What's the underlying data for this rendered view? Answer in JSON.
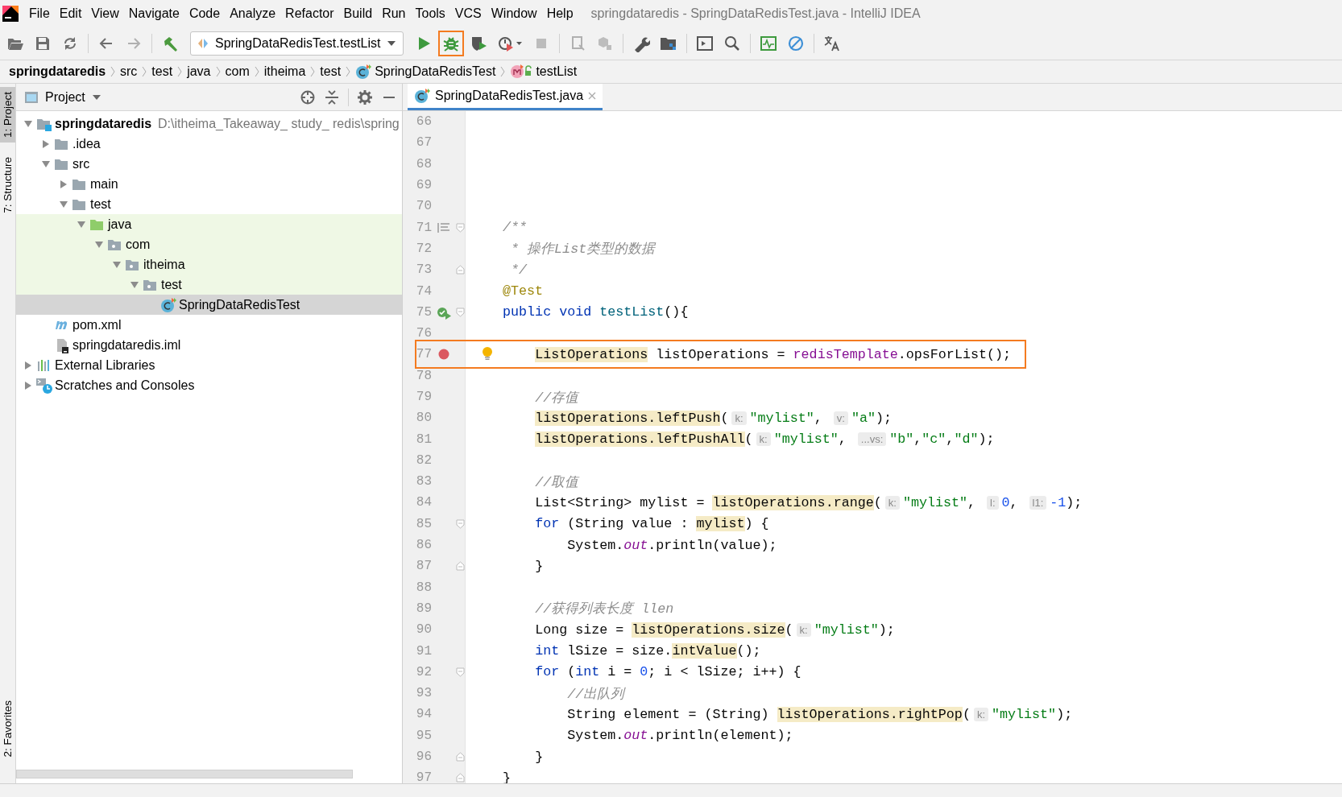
{
  "menu_bar": {
    "items": [
      "File",
      "Edit",
      "View",
      "Navigate",
      "Code",
      "Analyze",
      "Refactor",
      "Build",
      "Run",
      "Tools",
      "VCS",
      "Window",
      "Help"
    ],
    "title": "springdataredis - SpringDataRedisTest.java - IntelliJ IDEA"
  },
  "toolbar": {
    "run_configuration": "SpringDataRedisTest.testList",
    "debug_button": {
      "outlined": true
    }
  },
  "breadcrumbs": [
    {
      "label": "springdataredis",
      "kind": "module"
    },
    {
      "label": "src",
      "kind": "folder"
    },
    {
      "label": "test",
      "kind": "folder"
    },
    {
      "label": "java",
      "kind": "folder"
    },
    {
      "label": "com",
      "kind": "folder"
    },
    {
      "label": "itheima",
      "kind": "folder"
    },
    {
      "label": "test",
      "kind": "folder"
    },
    {
      "label": "SpringDataRedisTest",
      "kind": "class"
    },
    {
      "label": "testList",
      "kind": "method"
    }
  ],
  "side_tabs_top": [
    {
      "label": "1: Project",
      "selected": true
    },
    {
      "label": "7: Structure",
      "selected": false
    }
  ],
  "side_tabs_bottom": [
    {
      "label": "2: Favorites",
      "selected": false
    }
  ],
  "project_panel": {
    "title": "Project",
    "tree": [
      {
        "label": "springdataredis",
        "path": "D:\\itheima_Takeaway_ study_ redis\\spring",
        "kind": "module",
        "expanded": true,
        "selected": false,
        "highlighted": false,
        "children": [
          {
            "label": ".idea",
            "kind": "folder",
            "expanded": false,
            "selected": false,
            "highlighted": false
          },
          {
            "label": "src",
            "kind": "folder",
            "expanded": true,
            "selected": false,
            "highlighted": false,
            "children": [
              {
                "label": "main",
                "kind": "folder",
                "expanded": false,
                "selected": false,
                "highlighted": false
              },
              {
                "label": "test",
                "kind": "folder",
                "expanded": true,
                "selected": false,
                "highlighted": false,
                "children": [
                  {
                    "label": "java",
                    "kind": "test-root",
                    "expanded": true,
                    "selected": false,
                    "highlighted": true,
                    "children": [
                      {
                        "label": "com",
                        "kind": "package",
                        "expanded": true,
                        "selected": false,
                        "highlighted": true,
                        "children": [
                          {
                            "label": "itheima",
                            "kind": "package",
                            "expanded": true,
                            "selected": false,
                            "highlighted": true,
                            "children": [
                              {
                                "label": "test",
                                "kind": "package",
                                "expanded": true,
                                "selected": false,
                                "highlighted": true,
                                "children": [
                                  {
                                    "label": "SpringDataRedisTest",
                                    "kind": "class",
                                    "selected": true,
                                    "highlighted": false
                                  }
                                ]
                              }
                            ]
                          }
                        ]
                      }
                    ]
                  }
                ]
              }
            ]
          },
          {
            "label": "pom.xml",
            "kind": "maven",
            "selected": false,
            "highlighted": false
          },
          {
            "label": "springdataredis.iml",
            "kind": "iml",
            "selected": false,
            "highlighted": false
          }
        ]
      },
      {
        "label": "External Libraries",
        "kind": "libraries",
        "expanded": false,
        "selected": false,
        "highlighted": false
      },
      {
        "label": "Scratches and Consoles",
        "kind": "scratches",
        "expanded": false,
        "selected": false,
        "highlighted": false
      }
    ]
  },
  "editor": {
    "tabs": [
      {
        "label": "SpringDataRedisTest.java",
        "selected": true
      }
    ],
    "lines": [
      {
        "number": "66"
      },
      {
        "number": "67"
      },
      {
        "number": "68"
      },
      {
        "number": "69"
      },
      {
        "number": "70"
      },
      {
        "number": "71",
        "gutter_icon": {
          "kind": "javadoc"
        },
        "fold_mark": {
          "kind": "start"
        },
        "tokens": [
          {
            "kind": "comment",
            "t": "    /**"
          }
        ]
      },
      {
        "number": "72",
        "tokens": [
          {
            "kind": "comment",
            "t": "     * 操作List类型的数据"
          }
        ]
      },
      {
        "number": "73",
        "fold_mark": {
          "kind": "end"
        },
        "tokens": [
          {
            "kind": "comment",
            "t": "     */"
          }
        ]
      },
      {
        "number": "74",
        "tokens": [
          {
            "kind": "annotation",
            "t": "    @Test"
          }
        ]
      },
      {
        "number": "75",
        "gutter_icon": {
          "kind": "run"
        },
        "fold_mark": {
          "kind": "start"
        },
        "tokens": [
          {
            "kind": "keyword",
            "t": "    public void "
          },
          {
            "kind": "declaration",
            "t": "testList"
          },
          {
            "kind": "plain",
            "t": "(){"
          }
        ]
      },
      {
        "number": "76"
      },
      {
        "number": "77",
        "gutter_icon": {
          "kind": "breakpoint"
        },
        "bulb": true,
        "boxed": true,
        "tokens": [
          {
            "kind": "highlight",
            "t": "        ListOperations"
          },
          {
            "kind": "plain",
            "t": " listOperations = "
          },
          {
            "kind": "field",
            "t": "redisTemplate"
          },
          {
            "kind": "plain",
            "t": ".opsForList();"
          }
        ]
      },
      {
        "number": "78"
      },
      {
        "number": "79",
        "tokens": [
          {
            "kind": "comment",
            "t": "        //存值"
          }
        ]
      },
      {
        "number": "80",
        "tokens": [
          {
            "kind": "highlight",
            "t": "        listOperations.leftPush"
          },
          {
            "kind": "plain",
            "t": "("
          },
          {
            "kind": "hint",
            "t": "k:"
          },
          {
            "kind": "string",
            "t": "\"mylist\""
          },
          {
            "kind": "plain",
            "t": ", "
          },
          {
            "kind": "hint",
            "t": "v:"
          },
          {
            "kind": "string",
            "t": "\"a\""
          },
          {
            "kind": "plain",
            "t": ");"
          }
        ]
      },
      {
        "number": "81",
        "tokens": [
          {
            "kind": "highlight",
            "t": "        listOperations.leftPushAll"
          },
          {
            "kind": "plain",
            "t": "("
          },
          {
            "kind": "hint",
            "t": "k:"
          },
          {
            "kind": "string",
            "t": "\"mylist\""
          },
          {
            "kind": "plain",
            "t": ", "
          },
          {
            "kind": "hint",
            "t": "...vs:"
          },
          {
            "kind": "string",
            "t": "\"b\""
          },
          {
            "kind": "plain",
            "t": ","
          },
          {
            "kind": "string",
            "t": "\"c\""
          },
          {
            "kind": "plain",
            "t": ","
          },
          {
            "kind": "string",
            "t": "\"d\""
          },
          {
            "kind": "plain",
            "t": ");"
          }
        ]
      },
      {
        "number": "82"
      },
      {
        "number": "83",
        "tokens": [
          {
            "kind": "comment",
            "t": "        //取值"
          }
        ]
      },
      {
        "number": "84",
        "tokens": [
          {
            "kind": "plain",
            "t": "        List<String> mylist = "
          },
          {
            "kind": "highlight",
            "t": "listOperations.range"
          },
          {
            "kind": "plain",
            "t": "("
          },
          {
            "kind": "hint",
            "t": "k:"
          },
          {
            "kind": "string",
            "t": "\"mylist\""
          },
          {
            "kind": "plain",
            "t": ", "
          },
          {
            "kind": "hint",
            "t": "l:"
          },
          {
            "kind": "number",
            "t": "0"
          },
          {
            "kind": "plain",
            "t": ", "
          },
          {
            "kind": "hint",
            "t": "l1:"
          },
          {
            "kind": "number",
            "t": "-1"
          },
          {
            "kind": "plain",
            "t": ");"
          }
        ]
      },
      {
        "number": "85",
        "fold_mark": {
          "kind": "start"
        },
        "tokens": [
          {
            "kind": "keyword",
            "t": "        for"
          },
          {
            "kind": "plain",
            "t": " (String value : "
          },
          {
            "kind": "highlight",
            "t": "mylist"
          },
          {
            "kind": "plain",
            "t": ") {"
          }
        ]
      },
      {
        "number": "86",
        "tokens": [
          {
            "kind": "plain",
            "t": "            System."
          },
          {
            "kind": "static",
            "t": "out"
          },
          {
            "kind": "plain",
            "t": ".println(value);"
          }
        ]
      },
      {
        "number": "87",
        "fold_mark": {
          "kind": "end"
        },
        "tokens": [
          {
            "kind": "plain",
            "t": "        }"
          }
        ]
      },
      {
        "number": "88"
      },
      {
        "number": "89",
        "tokens": [
          {
            "kind": "comment",
            "t": "        //获得列表长度 llen"
          }
        ]
      },
      {
        "number": "90",
        "tokens": [
          {
            "kind": "plain",
            "t": "        Long size = "
          },
          {
            "kind": "highlight",
            "t": "listOperations.size"
          },
          {
            "kind": "plain",
            "t": "("
          },
          {
            "kind": "hint",
            "t": "k:"
          },
          {
            "kind": "string",
            "t": "\"mylist\""
          },
          {
            "kind": "plain",
            "t": ");"
          }
        ]
      },
      {
        "number": "91",
        "tokens": [
          {
            "kind": "keyword",
            "t": "        int"
          },
          {
            "kind": "plain",
            "t": " lSize = size."
          },
          {
            "kind": "highlight",
            "t": "intValue"
          },
          {
            "kind": "plain",
            "t": "();"
          }
        ]
      },
      {
        "number": "92",
        "fold_mark": {
          "kind": "start"
        },
        "tokens": [
          {
            "kind": "keyword",
            "t": "        for"
          },
          {
            "kind": "plain",
            "t": " ("
          },
          {
            "kind": "keyword",
            "t": "int"
          },
          {
            "kind": "plain",
            "t": " i = "
          },
          {
            "kind": "number",
            "t": "0"
          },
          {
            "kind": "plain",
            "t": "; i < lSize; i++) {"
          }
        ]
      },
      {
        "number": "93",
        "tokens": [
          {
            "kind": "comment",
            "t": "            //出队列"
          }
        ]
      },
      {
        "number": "94",
        "tokens": [
          {
            "kind": "plain",
            "t": "            String element = (String) "
          },
          {
            "kind": "highlight",
            "t": "listOperations.rightPop"
          },
          {
            "kind": "plain",
            "t": "("
          },
          {
            "kind": "hint",
            "t": "k:"
          },
          {
            "kind": "string",
            "t": "\"mylist\""
          },
          {
            "kind": "plain",
            "t": ");"
          }
        ]
      },
      {
        "number": "95",
        "tokens": [
          {
            "kind": "plain",
            "t": "            System."
          },
          {
            "kind": "static",
            "t": "out"
          },
          {
            "kind": "plain",
            "t": ".println(element);"
          }
        ]
      },
      {
        "number": "96",
        "fold_mark": {
          "kind": "end"
        },
        "tokens": [
          {
            "kind": "plain",
            "t": "        }"
          }
        ]
      },
      {
        "number": "97",
        "fold_mark": {
          "kind": "end"
        },
        "tokens": [
          {
            "kind": "plain",
            "t": "    }"
          }
        ]
      }
    ]
  }
}
